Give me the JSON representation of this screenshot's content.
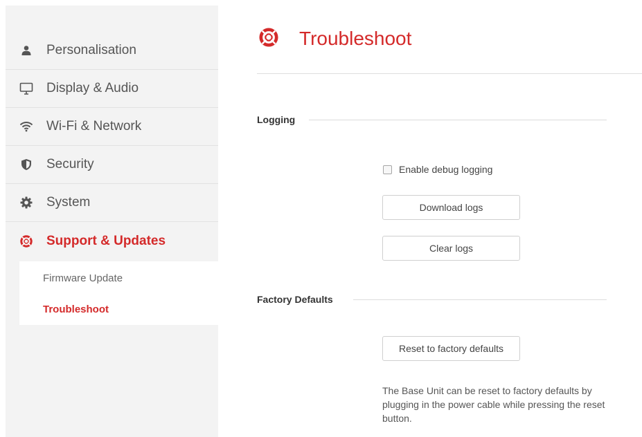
{
  "sidebar": {
    "items": [
      {
        "label": "Personalisation",
        "icon": "person-icon"
      },
      {
        "label": "Display & Audio",
        "icon": "monitor-icon"
      },
      {
        "label": "Wi-Fi & Network",
        "icon": "wifi-icon"
      },
      {
        "label": "Security",
        "icon": "shield-icon"
      },
      {
        "label": "System",
        "icon": "gear-icon"
      },
      {
        "label": "Support & Updates",
        "icon": "lifebuoy-icon"
      }
    ],
    "submenu": [
      {
        "label": "Firmware Update"
      },
      {
        "label": "Troubleshoot"
      }
    ]
  },
  "page": {
    "title": "Troubleshoot",
    "title_icon": "lifebuoy-icon"
  },
  "logging": {
    "title": "Logging",
    "debug_label": "Enable debug logging",
    "debug_checked": false,
    "download_label": "Download logs",
    "clear_label": "Clear logs"
  },
  "factory": {
    "title": "Factory Defaults",
    "reset_label": "Reset to factory defaults",
    "note": "The Base Unit can be reset to factory defaults by plugging in the power cable while pressing the reset button."
  },
  "colors": {
    "accent": "#d42a2a",
    "sidebar_bg": "#f3f3f3"
  }
}
